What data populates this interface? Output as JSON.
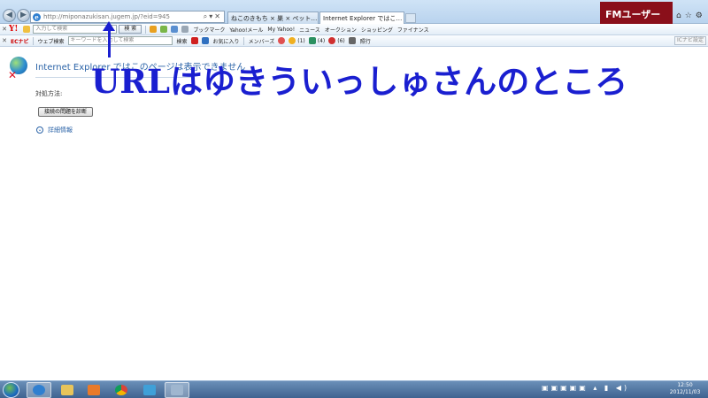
{
  "browser": {
    "url": "http://miponazukisan.jugem.jp/?eid=945",
    "tabs": [
      {
        "label": "ねこのきもち × 巣 × ペット…"
      },
      {
        "label": "Internet Explorer ではこ…"
      }
    ],
    "corner_badge": "FMユーザー"
  },
  "toolbar1": {
    "search_placeholder": "入力して検索",
    "search_button": "検 索",
    "items": [
      "ブックマーク",
      "Yahoo!メール",
      "My Yahoo!",
      "ニュース",
      "オークション",
      "ショッピング",
      "ファイナンス"
    ]
  },
  "toolbar2": {
    "brand": "ECナビ",
    "web_search": "ウェブ検索",
    "keyword_placeholder": "キーワードを入力して検索",
    "search_button": "検索",
    "items": [
      "お気に入り",
      "メンバーズ",
      "(1)",
      "(4)",
      "(6)",
      "照行"
    ],
    "right_button": "ICナビ設定"
  },
  "page": {
    "error_title": "Internet Explorer ではこのページは表示できません",
    "action_label": "対処方法:",
    "diagnose_button": "接続の問題を診断",
    "details_link": "詳細情報"
  },
  "annotation": {
    "text": "URLはゆきういっしゅさんのところ",
    "color": "#1a1fd0"
  },
  "taskbar": {
    "time": "12:50",
    "date": "2012/11/03"
  }
}
